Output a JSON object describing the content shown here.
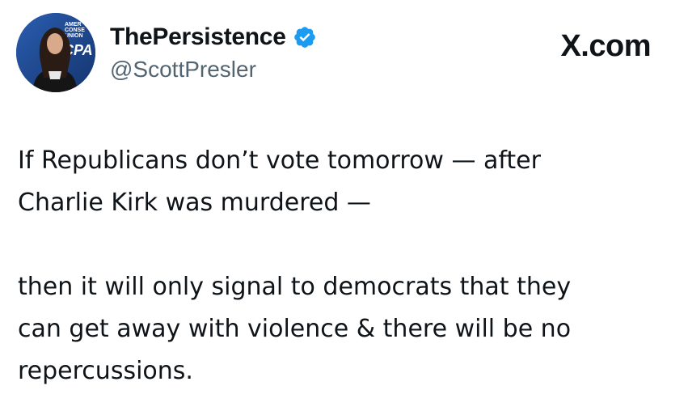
{
  "tweet": {
    "display_name": "ThePersistence",
    "handle": "@ScottPresler",
    "verified": true,
    "verified_color": "#1d9bf0",
    "brand": "X.com",
    "paragraphs": [
      {
        "lines": [
          "If Republicans don’t vote tomorrow — after",
          "Charlie Kirk was murdered —"
        ]
      },
      {
        "lines": [
          "then it will only signal to democrats that they",
          "can get away with violence & there will be no",
          "repercussions."
        ]
      }
    ],
    "avatar_sign_text": [
      "AMER",
      "CONSE",
      "UNION",
      "CPA"
    ]
  }
}
